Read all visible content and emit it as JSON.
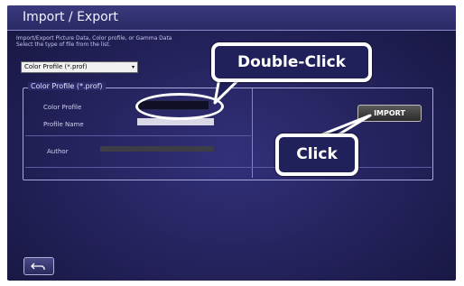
{
  "window": {
    "title": "Import / Export"
  },
  "description": {
    "line1": "Import/Export Picture Data, Color profile, or Gamma Data",
    "line2": "Select the type of file from the list."
  },
  "file_type_select": {
    "value": "Color Profile (*.prof)",
    "arrow": "▾"
  },
  "panel": {
    "legend": "Color Profile (*.prof)",
    "fields": {
      "color_profile_label": "Color Profile",
      "profile_name_label": "Profile Name",
      "author_label": "Author"
    },
    "import_label": "IMPORT"
  },
  "callouts": {
    "double_click": "Double-Click",
    "click": "Click"
  },
  "back_button": {
    "icon": "return-arrow-icon"
  },
  "colors": {
    "background": "#26245f",
    "callout_fill": "#20205a",
    "callout_border": "#ffffff"
  }
}
